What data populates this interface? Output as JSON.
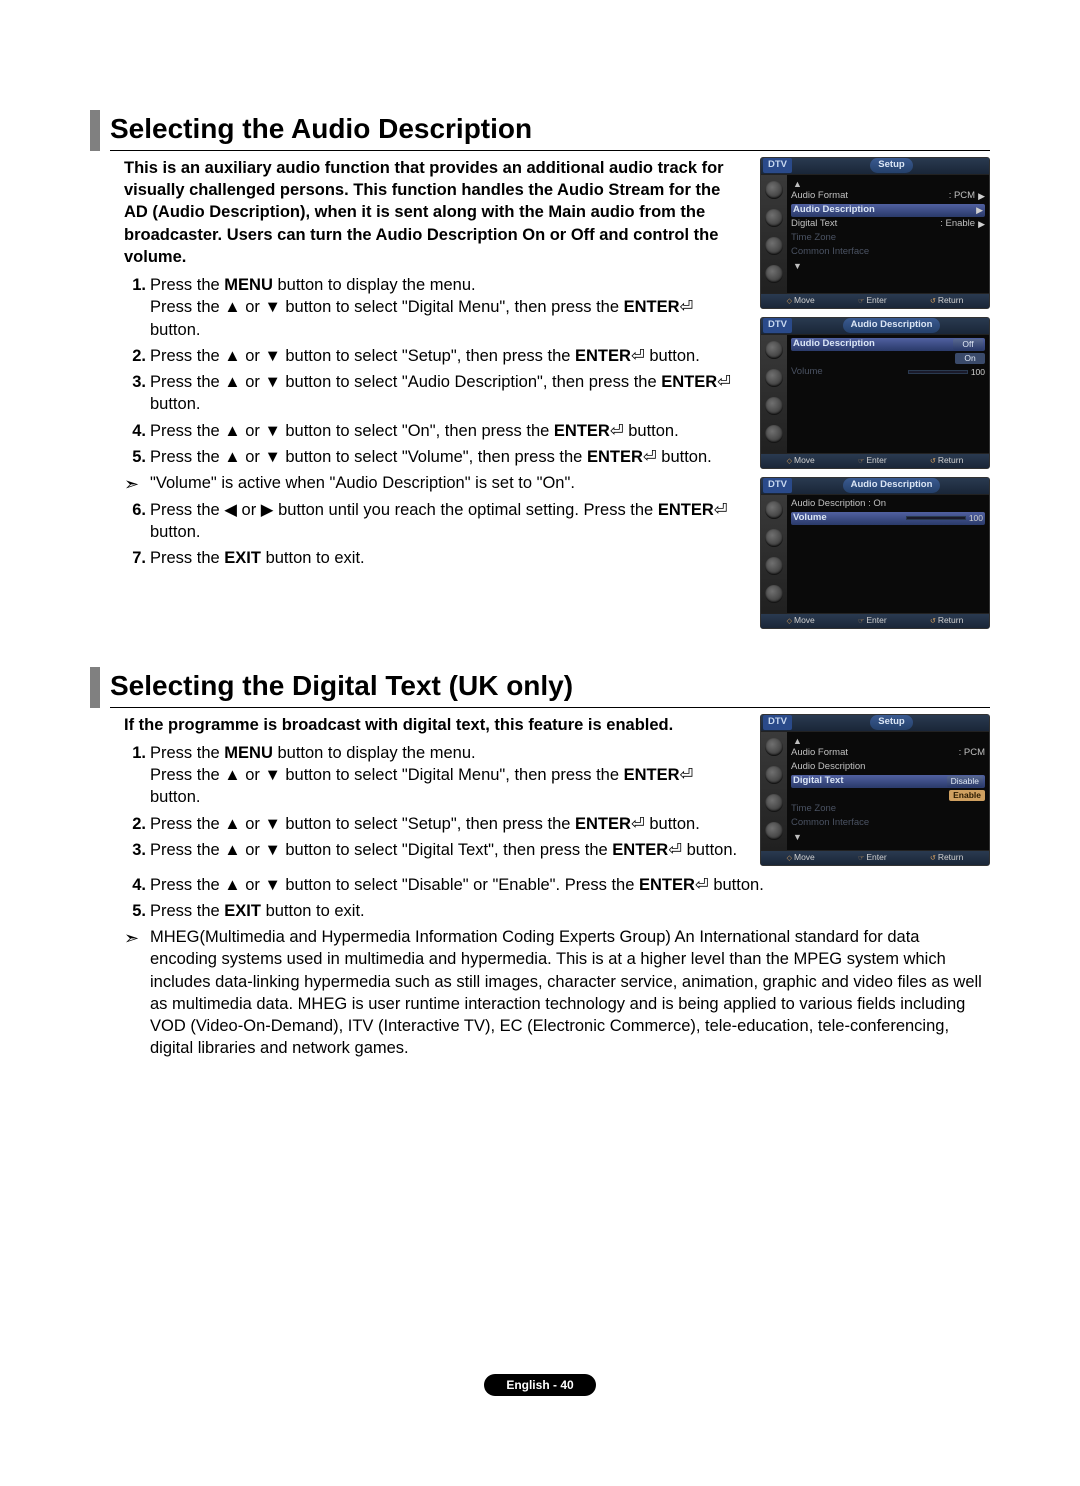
{
  "sections": [
    {
      "title": "Selecting the Audio Description",
      "intro": "This is an auxiliary audio function that provides an additional audio track for visually challenged persons. This function handles the Audio Stream for the AD (Audio Description), when it is sent along with the Main audio from the broadcaster. Users can turn the Audio Description On or Off and control the volume.",
      "steps": [
        "Press the <b>MENU</b> button to display the menu.<br>Press the ▲ or ▼ button to select \"Digital Menu\", then press the <b>ENTER</b>⏎ button.",
        "Press the ▲ or ▼ button to select \"Setup\", then press the <b>ENTER</b>⏎ button.",
        "Press the ▲ or ▼ button to select \"Audio Description\", then press the <b>ENTER</b>⏎ button.",
        "Press the ▲ or ▼ button to select \"On\", then press the <b>ENTER</b>⏎ button.",
        "Press the ▲ or ▼ button to select \"Volume\", then press the <b>ENTER</b>⏎ button."
      ],
      "steps2": [
        "Press the ◀ or ▶ button until you reach the optimal setting. Press the <b>ENTER</b>⏎ button.",
        "Press the <b>EXIT</b> button to exit."
      ],
      "note_after_5": "\"Volume\" is active when \"Audio Description\" is set to \"On\"."
    },
    {
      "title": "Selecting the Digital Text (UK only)",
      "intro": "If the programme is broadcast with digital text, this feature is enabled.",
      "steps": [
        "Press the <b>MENU</b> button to display the menu.<br>Press the ▲ or ▼ button to select \"Digital Menu\", then press the <b>ENTER</b>⏎ button.",
        "Press the ▲ or ▼ button to select \"Setup\", then press the <b>ENTER</b>⏎ button.",
        "Press the ▲ or ▼ button to select \"Digital Text\", then press the <b>ENTER</b>⏎ button.",
        "Press the ▲ or ▼ button to select \"Disable\" or \"Enable\". Press the <b>ENTER</b>⏎ button.",
        "Press the <b>EXIT</b> button to exit."
      ],
      "note": "MHEG(Multimedia and Hypermedia Information Coding Experts Group) An International standard for data encoding systems used in multimedia and hypermedia. This is at a higher level than the MPEG system which includes data-linking hypermedia such as still images, character service, animation, graphic and video files as well as multimedia data. MHEG is user runtime interaction technology and is being applied to various fields including VOD (Video-On-Demand), ITV (Interactive TV), EC (Electronic Commerce), tele-education, tele-conferencing, digital libraries and network games."
    }
  ],
  "tv": {
    "dtv": "DTV",
    "setup": "Setup",
    "audio_desc": "Audio Description",
    "audio_format": "Audio Format",
    "pcm": ": PCM",
    "digital_text": "Digital Text",
    "enable": ": Enable",
    "time_zone": "Time Zone",
    "common_interface": "Common Interface",
    "off": "Off",
    "on": "On",
    "volume": "Volume",
    "vol_val": "100",
    "ad_on": "Audio Description : On",
    "disable": "Disable",
    "enable_pill": "Enable",
    "move": "Move",
    "enter": "Enter",
    "return": "Return"
  },
  "footer": "English - 40"
}
